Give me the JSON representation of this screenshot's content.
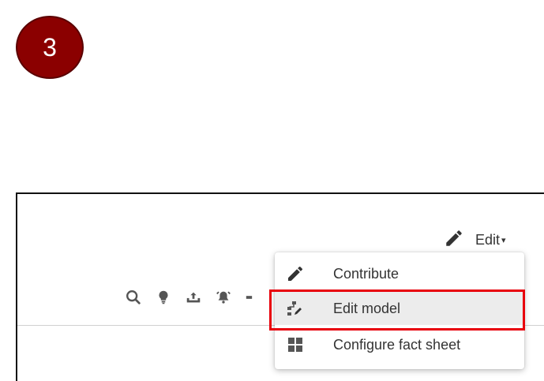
{
  "step_badge": {
    "number": "3",
    "color": "#8b0000"
  },
  "header": {
    "edit_icon": "pencil-icon",
    "edit_label": "Edit",
    "edit_caret": "▾"
  },
  "toolbar": {
    "icons": [
      "search-icon",
      "lightbulb-icon",
      "upload-icon",
      "alarm-bell-icon",
      "more-icon"
    ]
  },
  "edit_menu": {
    "items": [
      {
        "label": "Contribute",
        "icon": "pencil-icon"
      },
      {
        "label": "Edit model",
        "icon": "model-edit-icon",
        "highlighted": true
      },
      {
        "label": "Configure fact sheet",
        "icon": "grid-icon"
      }
    ]
  },
  "annotation": {
    "highlight_color": "#e8000b"
  }
}
